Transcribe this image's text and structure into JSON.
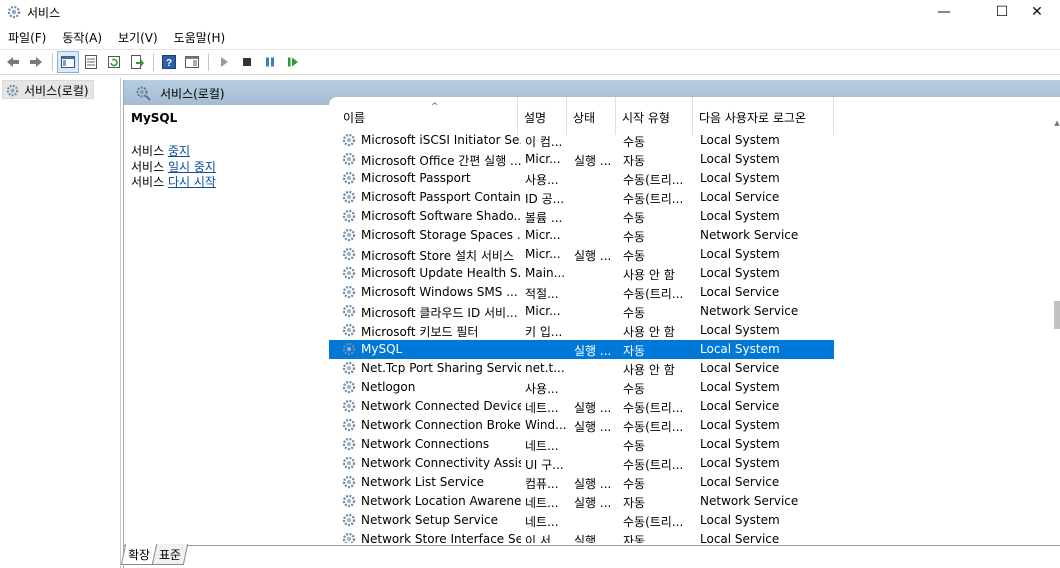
{
  "window": {
    "title": "서비스",
    "minimize": "—",
    "maximize": "☐",
    "close": "✕"
  },
  "menu": [
    "파일(F)",
    "동작(A)",
    "보기(V)",
    "도움말(H)"
  ],
  "tree": {
    "root_label": "서비스(로컬)"
  },
  "pane": {
    "header_title": "서비스(로컬)"
  },
  "detail": {
    "service_name": "MySQL",
    "actions": [
      {
        "prefix": "서비스 ",
        "link": "중지"
      },
      {
        "prefix": "서비스 ",
        "link": "일시 중지"
      },
      {
        "prefix": "서비스 ",
        "link": "다시 시작"
      }
    ]
  },
  "columns": [
    "이름",
    "설명",
    "상태",
    "시작 유형",
    "다음 사용자로 로그온"
  ],
  "rows": [
    {
      "name": "Microsoft iSCSI Initiator Se...",
      "desc": "이 컴...",
      "status": "",
      "startup": "수동",
      "logon": "Local System"
    },
    {
      "name": "Microsoft Office 간편 실행 ...",
      "desc": "Micr...",
      "status": "실행 ...",
      "startup": "자동",
      "logon": "Local System"
    },
    {
      "name": "Microsoft Passport",
      "desc": "사용...",
      "status": "",
      "startup": "수동(트리...",
      "logon": "Local System"
    },
    {
      "name": "Microsoft Passport Container",
      "desc": "ID 공...",
      "status": "",
      "startup": "수동(트리...",
      "logon": "Local Service"
    },
    {
      "name": "Microsoft Software Shado...",
      "desc": "볼륨 ...",
      "status": "",
      "startup": "수동",
      "logon": "Local System"
    },
    {
      "name": "Microsoft Storage Spaces ...",
      "desc": "Micr...",
      "status": "",
      "startup": "수동",
      "logon": "Network Service"
    },
    {
      "name": "Microsoft Store 설치 서비스",
      "desc": "Micr...",
      "status": "실행 ...",
      "startup": "수동",
      "logon": "Local System"
    },
    {
      "name": "Microsoft Update Health S...",
      "desc": "Main...",
      "status": "",
      "startup": "사용 안 함",
      "logon": "Local System"
    },
    {
      "name": "Microsoft Windows SMS ...",
      "desc": "적절...",
      "status": "",
      "startup": "수동(트리...",
      "logon": "Local Service"
    },
    {
      "name": "Microsoft 클라우드 ID 서비...",
      "desc": "Micr...",
      "status": "",
      "startup": "수동",
      "logon": "Network Service"
    },
    {
      "name": "Microsoft 키보드 필터",
      "desc": "키 입...",
      "status": "",
      "startup": "사용 안 함",
      "logon": "Local System"
    },
    {
      "name": "MySQL",
      "desc": "",
      "status": "실행 ...",
      "startup": "자동",
      "logon": "Local System",
      "selected": true
    },
    {
      "name": "Net.Tcp Port Sharing Service",
      "desc": "net.t...",
      "status": "",
      "startup": "사용 안 함",
      "logon": "Local Service"
    },
    {
      "name": "Netlogon",
      "desc": "사용...",
      "status": "",
      "startup": "수동",
      "logon": "Local System"
    },
    {
      "name": "Network Connected Device...",
      "desc": "네트...",
      "status": "실행 ...",
      "startup": "수동(트리...",
      "logon": "Local Service"
    },
    {
      "name": "Network Connection Broker",
      "desc": "Wind...",
      "status": "실행 ...",
      "startup": "수동(트리...",
      "logon": "Local System"
    },
    {
      "name": "Network Connections",
      "desc": "네트...",
      "status": "",
      "startup": "수동",
      "logon": "Local System"
    },
    {
      "name": "Network Connectivity Assis...",
      "desc": "UI 구...",
      "status": "",
      "startup": "수동(트리...",
      "logon": "Local System"
    },
    {
      "name": "Network List Service",
      "desc": "컴퓨...",
      "status": "실행 ...",
      "startup": "수동",
      "logon": "Local Service"
    },
    {
      "name": "Network Location Awareness",
      "desc": "네트...",
      "status": "실행 ...",
      "startup": "자동",
      "logon": "Network Service"
    },
    {
      "name": "Network Setup Service",
      "desc": "네트...",
      "status": "",
      "startup": "수동(트리...",
      "logon": "Local System"
    },
    {
      "name": "Network Store Interface Se...",
      "desc": "이 서...",
      "status": "실행 ...",
      "startup": "자동",
      "logon": "Local Service"
    }
  ],
  "tabs": [
    "확장",
    "표준"
  ],
  "colors": {
    "selection": "#0078d7",
    "pane_header": "#a9c0d6",
    "link": "#0a4fa5"
  }
}
